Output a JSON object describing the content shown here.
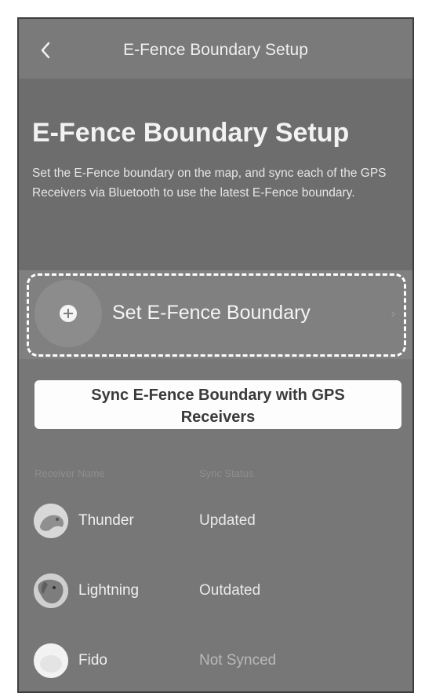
{
  "header": {
    "back_icon": "chevron-left-icon",
    "title": "E-Fence Boundary Setup"
  },
  "intro": {
    "heading": "E-Fence Boundary Setup",
    "description": "Set the E-Fence boundary on the map, and sync each of the GPS Receivers via Bluetooth to use the latest E-Fence boundary."
  },
  "set_boundary": {
    "icon": "plus-circle-icon",
    "label": "Set E-Fence Boundary",
    "chevron_icon": "chevron-right-icon"
  },
  "sync": {
    "button_label": "Sync E-Fence Boundary with GPS Receivers"
  },
  "receivers": {
    "columns": [
      "Receiver Name",
      "Sync Status"
    ],
    "rows": [
      {
        "name": "Thunder",
        "status": "Updated",
        "avatar_icon": "dog-avatar-icon"
      },
      {
        "name": "Lightning",
        "status": "Outdated",
        "avatar_icon": "dog-avatar-icon"
      },
      {
        "name": "Fido",
        "status": "Not Synced",
        "avatar_icon": "dog-avatar-icon"
      }
    ]
  },
  "colors": {
    "highlight_border": "#ffffff",
    "button_background": "#fdfdfd"
  }
}
